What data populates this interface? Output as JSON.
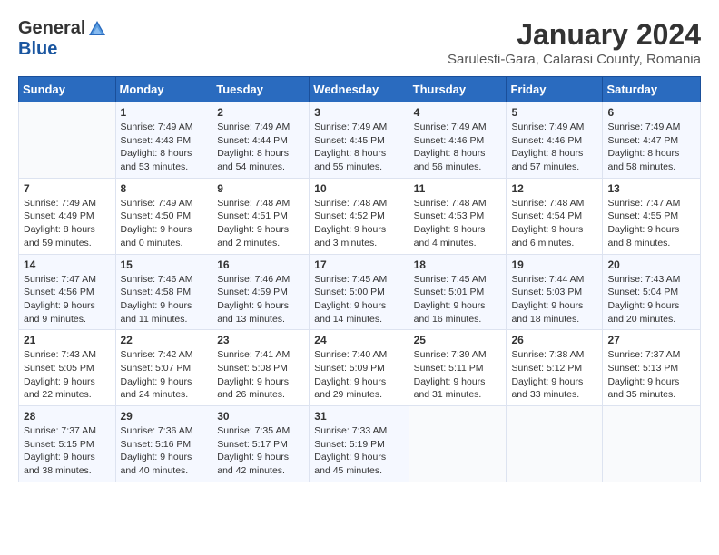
{
  "logo": {
    "general": "General",
    "blue": "Blue"
  },
  "title": "January 2024",
  "subtitle": "Sarulesti-Gara, Calarasi County, Romania",
  "days_of_week": [
    "Sunday",
    "Monday",
    "Tuesday",
    "Wednesday",
    "Thursday",
    "Friday",
    "Saturday"
  ],
  "weeks": [
    [
      {
        "day": "",
        "sunrise": "",
        "sunset": "",
        "daylight": ""
      },
      {
        "day": "1",
        "sunrise": "Sunrise: 7:49 AM",
        "sunset": "Sunset: 4:43 PM",
        "daylight": "Daylight: 8 hours and 53 minutes."
      },
      {
        "day": "2",
        "sunrise": "Sunrise: 7:49 AM",
        "sunset": "Sunset: 4:44 PM",
        "daylight": "Daylight: 8 hours and 54 minutes."
      },
      {
        "day": "3",
        "sunrise": "Sunrise: 7:49 AM",
        "sunset": "Sunset: 4:45 PM",
        "daylight": "Daylight: 8 hours and 55 minutes."
      },
      {
        "day": "4",
        "sunrise": "Sunrise: 7:49 AM",
        "sunset": "Sunset: 4:46 PM",
        "daylight": "Daylight: 8 hours and 56 minutes."
      },
      {
        "day": "5",
        "sunrise": "Sunrise: 7:49 AM",
        "sunset": "Sunset: 4:46 PM",
        "daylight": "Daylight: 8 hours and 57 minutes."
      },
      {
        "day": "6",
        "sunrise": "Sunrise: 7:49 AM",
        "sunset": "Sunset: 4:47 PM",
        "daylight": "Daylight: 8 hours and 58 minutes."
      }
    ],
    [
      {
        "day": "7",
        "sunrise": "Sunrise: 7:49 AM",
        "sunset": "Sunset: 4:49 PM",
        "daylight": "Daylight: 8 hours and 59 minutes."
      },
      {
        "day": "8",
        "sunrise": "Sunrise: 7:49 AM",
        "sunset": "Sunset: 4:50 PM",
        "daylight": "Daylight: 9 hours and 0 minutes."
      },
      {
        "day": "9",
        "sunrise": "Sunrise: 7:48 AM",
        "sunset": "Sunset: 4:51 PM",
        "daylight": "Daylight: 9 hours and 2 minutes."
      },
      {
        "day": "10",
        "sunrise": "Sunrise: 7:48 AM",
        "sunset": "Sunset: 4:52 PM",
        "daylight": "Daylight: 9 hours and 3 minutes."
      },
      {
        "day": "11",
        "sunrise": "Sunrise: 7:48 AM",
        "sunset": "Sunset: 4:53 PM",
        "daylight": "Daylight: 9 hours and 4 minutes."
      },
      {
        "day": "12",
        "sunrise": "Sunrise: 7:48 AM",
        "sunset": "Sunset: 4:54 PM",
        "daylight": "Daylight: 9 hours and 6 minutes."
      },
      {
        "day": "13",
        "sunrise": "Sunrise: 7:47 AM",
        "sunset": "Sunset: 4:55 PM",
        "daylight": "Daylight: 9 hours and 8 minutes."
      }
    ],
    [
      {
        "day": "14",
        "sunrise": "Sunrise: 7:47 AM",
        "sunset": "Sunset: 4:56 PM",
        "daylight": "Daylight: 9 hours and 9 minutes."
      },
      {
        "day": "15",
        "sunrise": "Sunrise: 7:46 AM",
        "sunset": "Sunset: 4:58 PM",
        "daylight": "Daylight: 9 hours and 11 minutes."
      },
      {
        "day": "16",
        "sunrise": "Sunrise: 7:46 AM",
        "sunset": "Sunset: 4:59 PM",
        "daylight": "Daylight: 9 hours and 13 minutes."
      },
      {
        "day": "17",
        "sunrise": "Sunrise: 7:45 AM",
        "sunset": "Sunset: 5:00 PM",
        "daylight": "Daylight: 9 hours and 14 minutes."
      },
      {
        "day": "18",
        "sunrise": "Sunrise: 7:45 AM",
        "sunset": "Sunset: 5:01 PM",
        "daylight": "Daylight: 9 hours and 16 minutes."
      },
      {
        "day": "19",
        "sunrise": "Sunrise: 7:44 AM",
        "sunset": "Sunset: 5:03 PM",
        "daylight": "Daylight: 9 hours and 18 minutes."
      },
      {
        "day": "20",
        "sunrise": "Sunrise: 7:43 AM",
        "sunset": "Sunset: 5:04 PM",
        "daylight": "Daylight: 9 hours and 20 minutes."
      }
    ],
    [
      {
        "day": "21",
        "sunrise": "Sunrise: 7:43 AM",
        "sunset": "Sunset: 5:05 PM",
        "daylight": "Daylight: 9 hours and 22 minutes."
      },
      {
        "day": "22",
        "sunrise": "Sunrise: 7:42 AM",
        "sunset": "Sunset: 5:07 PM",
        "daylight": "Daylight: 9 hours and 24 minutes."
      },
      {
        "day": "23",
        "sunrise": "Sunrise: 7:41 AM",
        "sunset": "Sunset: 5:08 PM",
        "daylight": "Daylight: 9 hours and 26 minutes."
      },
      {
        "day": "24",
        "sunrise": "Sunrise: 7:40 AM",
        "sunset": "Sunset: 5:09 PM",
        "daylight": "Daylight: 9 hours and 29 minutes."
      },
      {
        "day": "25",
        "sunrise": "Sunrise: 7:39 AM",
        "sunset": "Sunset: 5:11 PM",
        "daylight": "Daylight: 9 hours and 31 minutes."
      },
      {
        "day": "26",
        "sunrise": "Sunrise: 7:38 AM",
        "sunset": "Sunset: 5:12 PM",
        "daylight": "Daylight: 9 hours and 33 minutes."
      },
      {
        "day": "27",
        "sunrise": "Sunrise: 7:37 AM",
        "sunset": "Sunset: 5:13 PM",
        "daylight": "Daylight: 9 hours and 35 minutes."
      }
    ],
    [
      {
        "day": "28",
        "sunrise": "Sunrise: 7:37 AM",
        "sunset": "Sunset: 5:15 PM",
        "daylight": "Daylight: 9 hours and 38 minutes."
      },
      {
        "day": "29",
        "sunrise": "Sunrise: 7:36 AM",
        "sunset": "Sunset: 5:16 PM",
        "daylight": "Daylight: 9 hours and 40 minutes."
      },
      {
        "day": "30",
        "sunrise": "Sunrise: 7:35 AM",
        "sunset": "Sunset: 5:17 PM",
        "daylight": "Daylight: 9 hours and 42 minutes."
      },
      {
        "day": "31",
        "sunrise": "Sunrise: 7:33 AM",
        "sunset": "Sunset: 5:19 PM",
        "daylight": "Daylight: 9 hours and 45 minutes."
      },
      {
        "day": "",
        "sunrise": "",
        "sunset": "",
        "daylight": ""
      },
      {
        "day": "",
        "sunrise": "",
        "sunset": "",
        "daylight": ""
      },
      {
        "day": "",
        "sunrise": "",
        "sunset": "",
        "daylight": ""
      }
    ]
  ]
}
